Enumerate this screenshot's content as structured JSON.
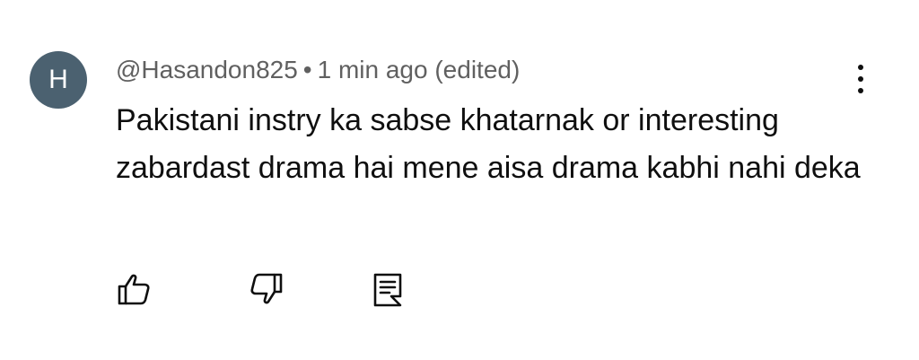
{
  "comment": {
    "avatar_letter": "H",
    "author": "@Hasandon825",
    "separator": "•",
    "time": "1 min ago (edited)",
    "text": "Pakistani instry ka sabse khatarnak or interesting zabardast drama hai mene aisa drama kabhi nahi deka"
  },
  "icons": {
    "more": "vertical-dots-icon",
    "like": "thumbs-up-icon",
    "dislike": "thumbs-down-icon",
    "reply": "reply-comment-icon"
  },
  "colors": {
    "avatar_bg": "#4b6170",
    "meta_text": "#606060",
    "body_text": "#0f0f0f",
    "background": "#ffffff"
  }
}
